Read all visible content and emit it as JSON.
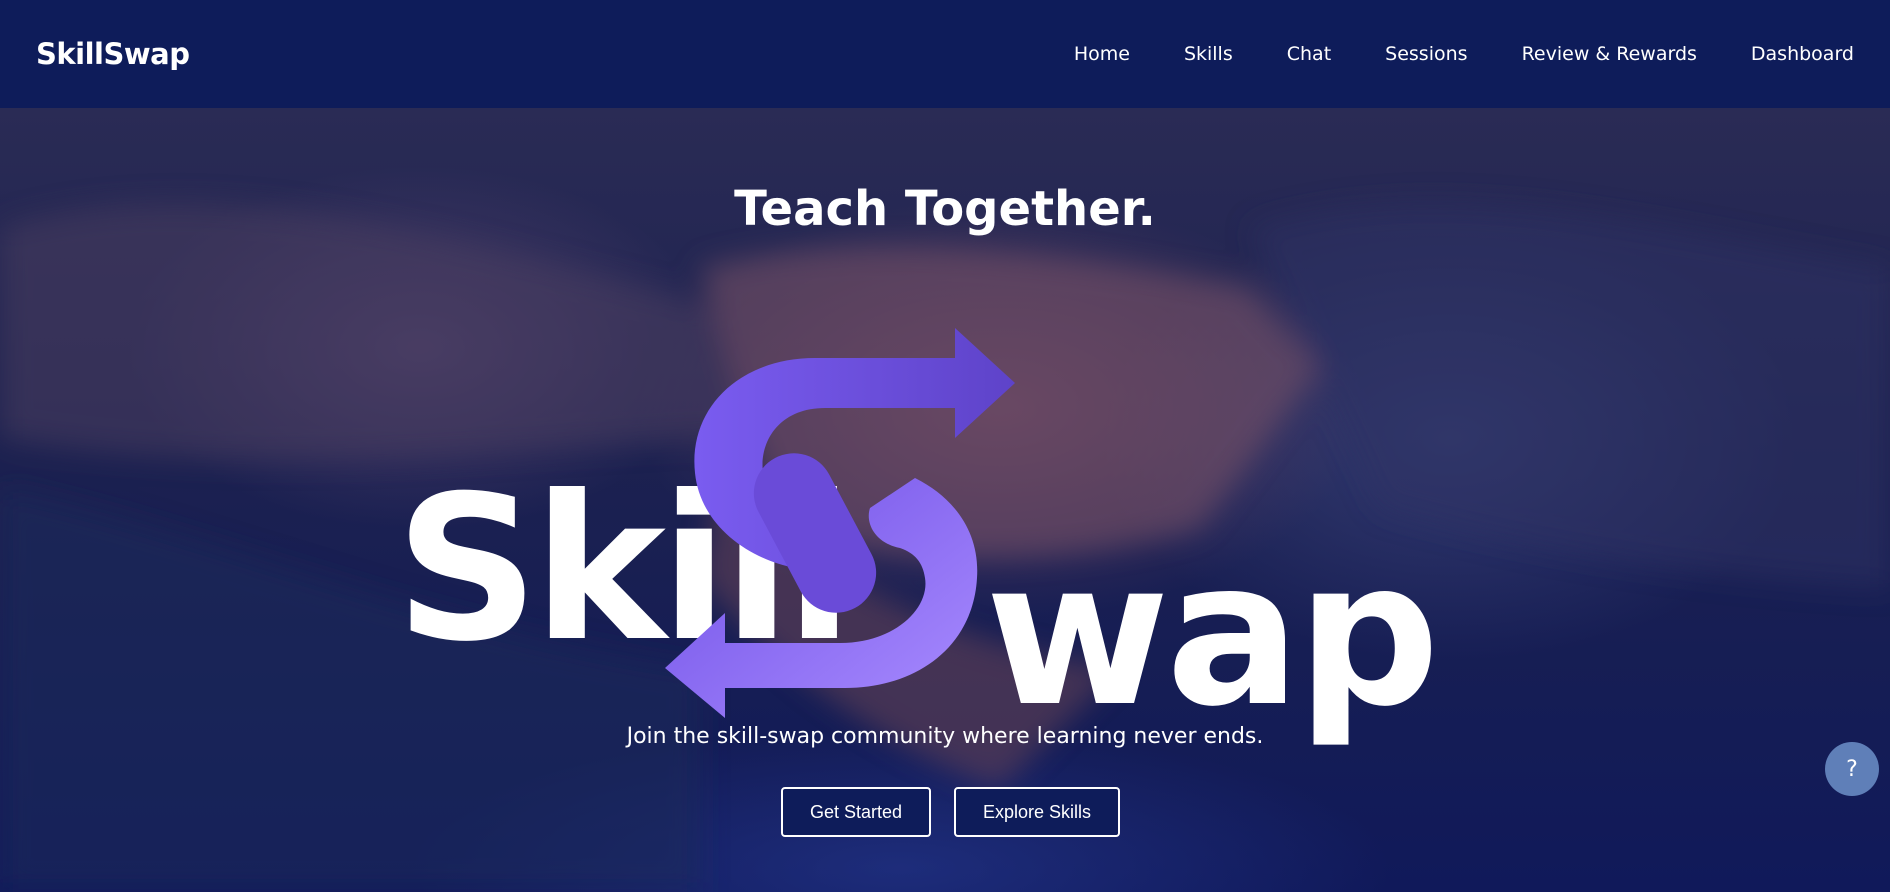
{
  "nav": {
    "brand": "SkillSwap",
    "links": [
      "Home",
      "Skills",
      "Chat",
      "Sessions",
      "Review & Rewards",
      "Dashboard"
    ]
  },
  "hero": {
    "title": "Teach Together.",
    "logo_text_left": "Skill",
    "logo_text_right": "wap",
    "subtitle": "Join the skill-swap community where learning never ends.",
    "primary_button": "Get Started",
    "secondary_button": "Explore Skills"
  },
  "help_button": "?",
  "colors": {
    "navbar": "#0e1c5a",
    "logo_purple": "#7a5cf0",
    "help_button": "#5f7fb8"
  }
}
